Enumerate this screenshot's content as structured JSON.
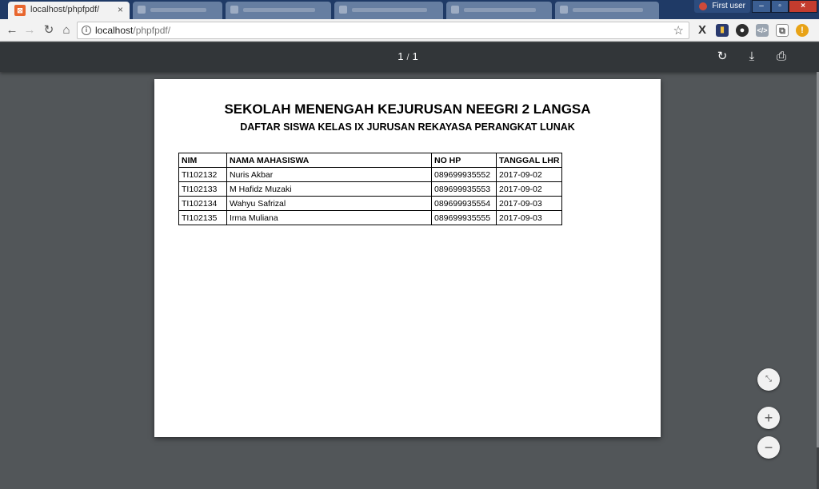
{
  "browser": {
    "active_tab": {
      "title": "localhost/phpfpdf/",
      "close": "×"
    },
    "window_user": "First user",
    "window_controls": {
      "minimize": "–",
      "maximize": "▫",
      "close": "×"
    },
    "address_bar": {
      "host": "localhost",
      "path": "/phpfpdf/",
      "info": "i"
    },
    "nav": {
      "back": "←",
      "forward": "→",
      "reload": "↻",
      "home": "⌂",
      "star": "☆"
    },
    "extensions": {
      "x": "X",
      "bars": "▮",
      "circle": "●",
      "code": "</>",
      "copy": "⧉",
      "warn": "!"
    }
  },
  "pdf_viewer": {
    "current_page": "1",
    "separator": "/",
    "total_pages": "1",
    "rotate": "↻",
    "download": "⤓",
    "print": "⎙",
    "fit": "⤡",
    "zoom_in": "+",
    "zoom_out": "−"
  },
  "document": {
    "title": "SEKOLAH MENENGAH KEJURUSAN NEEGRI 2 LANGSA",
    "subtitle": "DAFTAR SISWA KELAS IX JURUSAN REKAYASA PERANGKAT LUNAK",
    "table": {
      "headers": [
        "NIM",
        "NAMA MAHASISWA",
        "NO HP",
        "TANGGAL LHR"
      ],
      "rows": [
        [
          "TI102132",
          "Nuris Akbar",
          "089699935552",
          "2017-09-02"
        ],
        [
          "TI102133",
          "M Hafidz Muzaki",
          "089699935553",
          "2017-09-02"
        ],
        [
          "TI102134",
          "Wahyu Safrizal",
          "089699935554",
          "2017-09-03"
        ],
        [
          "TI102135",
          "Irma Muliana",
          "089699935555",
          "2017-09-03"
        ]
      ]
    }
  }
}
